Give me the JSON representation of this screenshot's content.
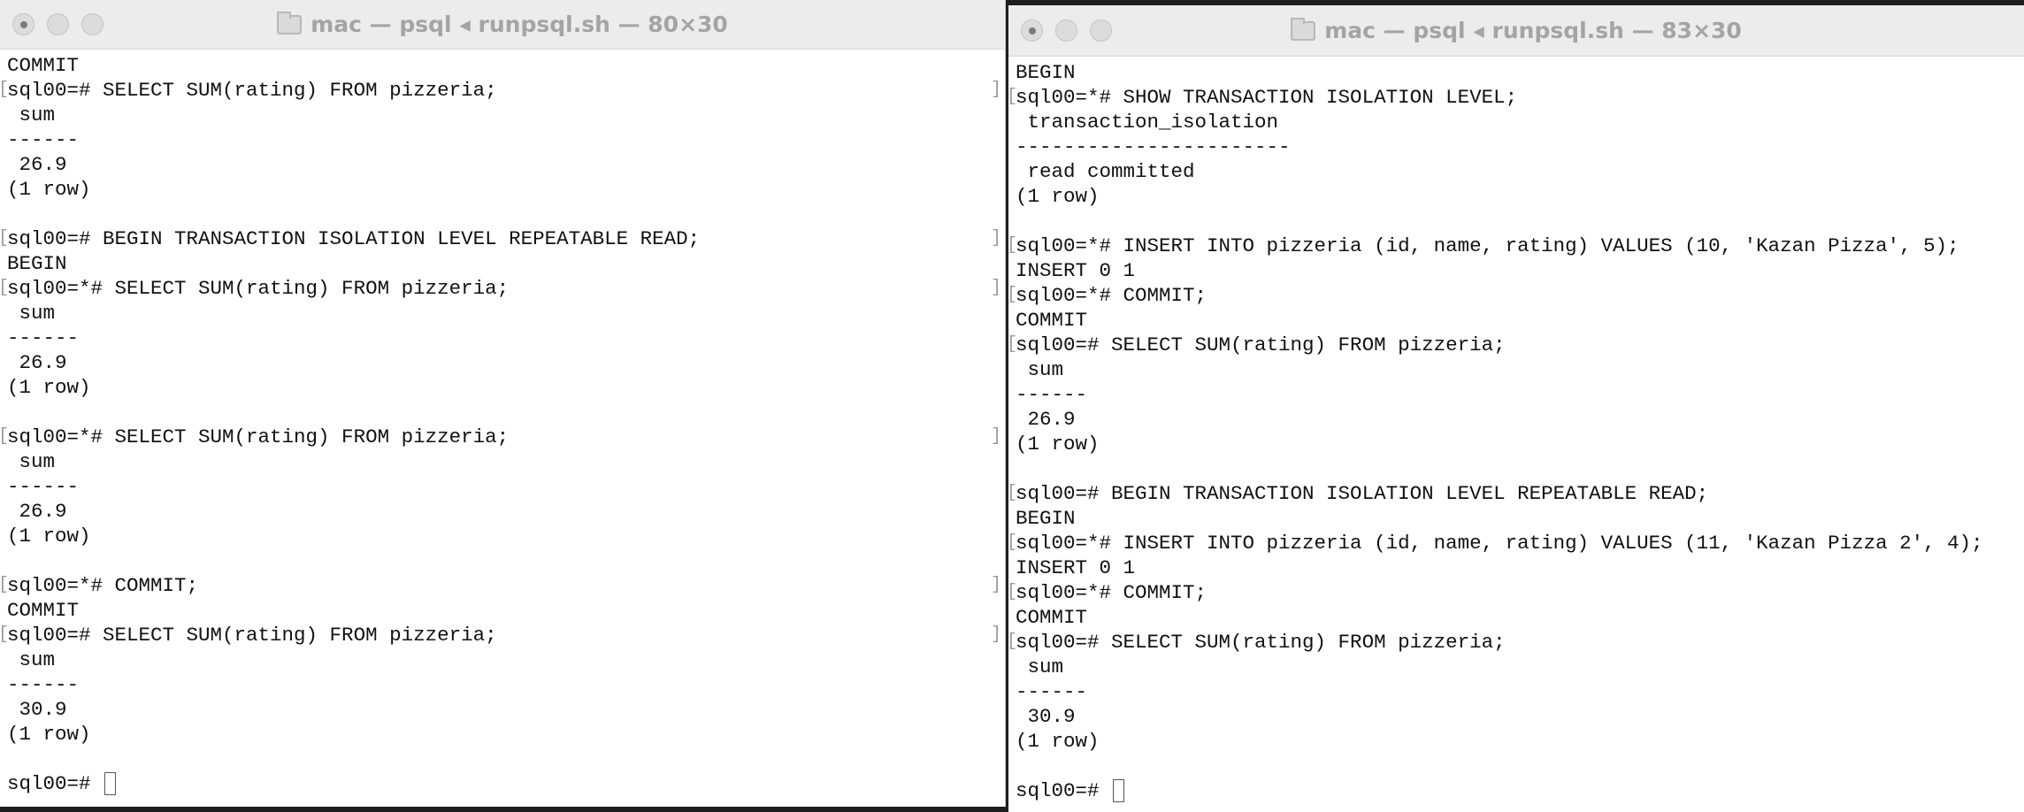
{
  "left_window": {
    "title": "mac — psql ◂ runpsql.sh — 80×30",
    "lines": [
      "COMMIT",
      "sql00=# SELECT SUM(rating) FROM pizzeria;",
      " sum",
      "------",
      " 26.9",
      "(1 row)",
      "",
      "sql00=# BEGIN TRANSACTION ISOLATION LEVEL REPEATABLE READ;",
      "BEGIN",
      "sql00=*# SELECT SUM(rating) FROM pizzeria;",
      " sum",
      "------",
      " 26.9",
      "(1 row)",
      "",
      "sql00=*# SELECT SUM(rating) FROM pizzeria;",
      " sum",
      "------",
      " 26.9",
      "(1 row)",
      "",
      "sql00=*# COMMIT;",
      "COMMIT",
      "sql00=# SELECT SUM(rating) FROM pizzeria;",
      " sum",
      "------",
      " 30.9",
      "(1 row)",
      ""
    ],
    "prompt": "sql00=# "
  },
  "right_window": {
    "title": "mac — psql ◂ runpsql.sh — 83×30",
    "lines": [
      "BEGIN",
      "sql00=*# SHOW TRANSACTION ISOLATION LEVEL;",
      " transaction_isolation",
      "-----------------------",
      " read committed",
      "(1 row)",
      "",
      "sql00=*# INSERT INTO pizzeria (id, name, rating) VALUES (10, 'Kazan Pizza', 5);",
      "INSERT 0 1",
      "sql00=*# COMMIT;",
      "COMMIT",
      "sql00=# SELECT SUM(rating) FROM pizzeria;",
      " sum",
      "------",
      " 26.9",
      "(1 row)",
      "",
      "sql00=# BEGIN TRANSACTION ISOLATION LEVEL REPEATABLE READ;",
      "BEGIN",
      "sql00=*# INSERT INTO pizzeria (id, name, rating) VALUES (11, 'Kazan Pizza 2', 4);",
      "INSERT 0 1",
      "sql00=*# COMMIT;",
      "COMMIT",
      "sql00=# SELECT SUM(rating) FROM pizzeria;",
      " sum",
      "------",
      " 30.9",
      "(1 row)",
      ""
    ],
    "prompt": "sql00=# "
  },
  "icons": {
    "close": "close-icon",
    "minimize": "minimize-icon",
    "zoom": "zoom-icon",
    "folder": "folder-icon"
  }
}
